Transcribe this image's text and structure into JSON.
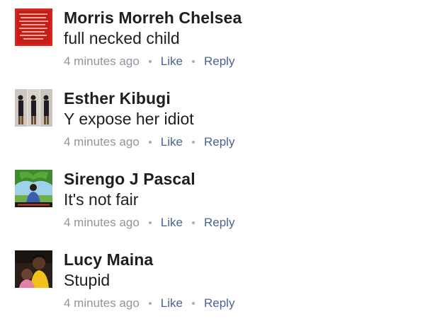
{
  "comments": [
    {
      "author": "Morris Morreh Chelsea",
      "text": "full necked child",
      "time": "4 minutes ago",
      "like_label": "Like",
      "reply_label": "Reply",
      "avatar_icon": "red-text-poster-avatar"
    },
    {
      "author": "Esther Kibugi",
      "text": "Y expose her idiot",
      "time": "4 minutes ago",
      "like_label": "Like",
      "reply_label": "Reply",
      "avatar_icon": "three-figures-avatar"
    },
    {
      "author": "Sirengo J Pascal",
      "text": "It's not fair",
      "time": "4 minutes ago",
      "like_label": "Like",
      "reply_label": "Reply",
      "avatar_icon": "man-under-tree-avatar"
    },
    {
      "author": "Lucy Maina",
      "text": "Stupid",
      "time": "4 minutes ago",
      "like_label": "Like",
      "reply_label": "Reply",
      "avatar_icon": "two-people-selfie-avatar"
    }
  ]
}
